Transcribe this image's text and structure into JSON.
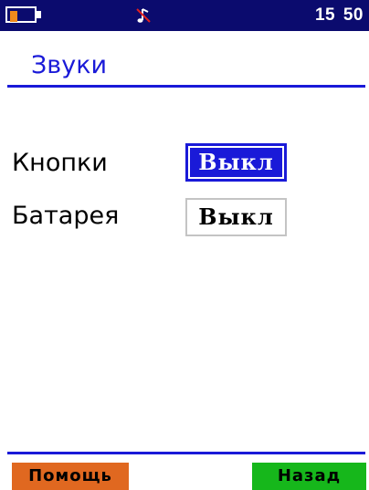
{
  "status_bar": {
    "battery_level": 0.35,
    "battery_icon": "battery-icon",
    "sound_icon": "sound-off-icon",
    "time": "15 50",
    "background_color": "#0b0b6e"
  },
  "screen": {
    "title": "Звуки",
    "accent_color": "#1a1ad8"
  },
  "settings": [
    {
      "label": "Кнопки",
      "value": "Выкл",
      "selected": true
    },
    {
      "label": "Батарея",
      "value": "Выкл",
      "selected": false
    }
  ],
  "footer": {
    "help_label": "Помощь",
    "help_color": "#e06820",
    "back_label": "Назад",
    "back_color": "#16b71b"
  }
}
